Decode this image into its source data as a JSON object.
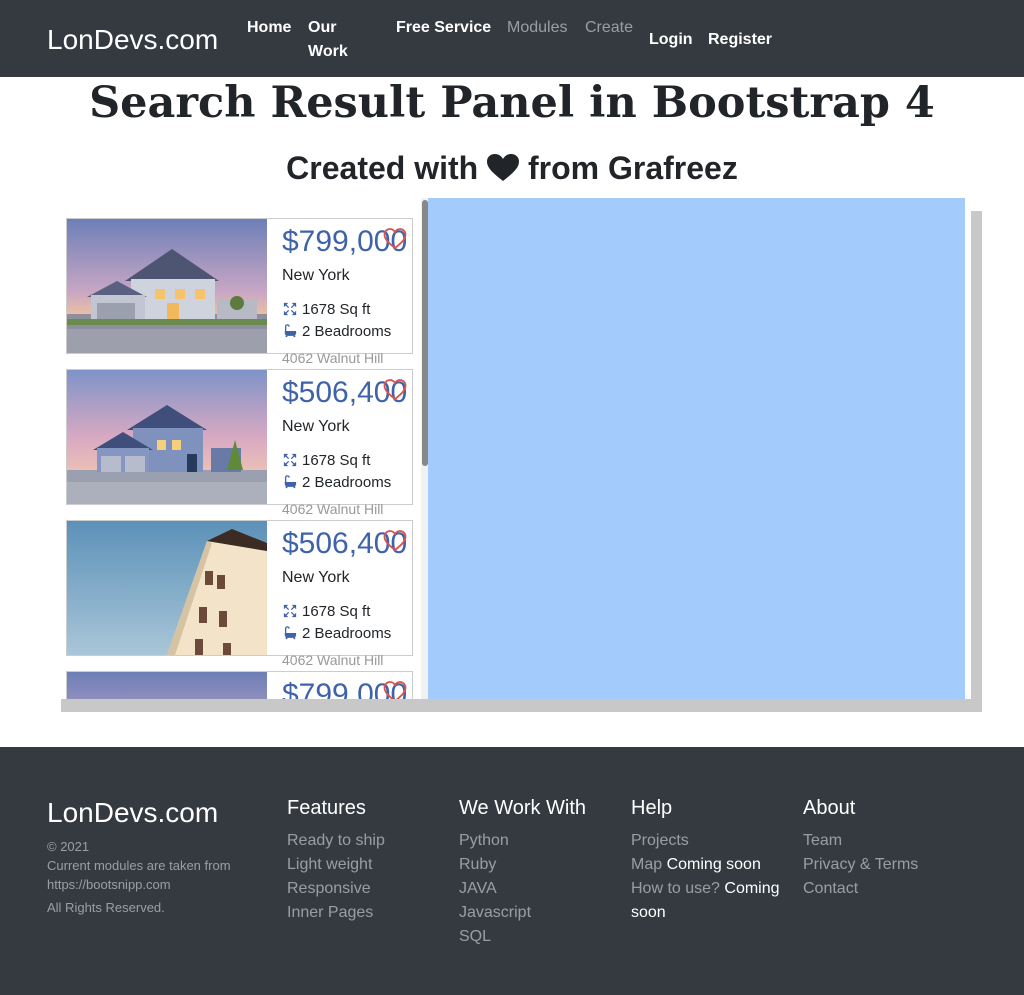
{
  "navbar": {
    "brand": "LonDevs.com",
    "items": [
      {
        "label": "Home",
        "active": true
      },
      {
        "label": "Our",
        "label2": "Work"
      },
      {
        "label": "Free Service"
      },
      {
        "label": "Modules",
        "muted": true
      },
      {
        "label": "Create",
        "muted": true
      },
      {
        "label": "Login"
      },
      {
        "label": "Register"
      }
    ]
  },
  "header": {
    "title": "Search Result Panel in Bootstrap 4",
    "subtitle_before": "Created with",
    "subtitle_after": "from Grafreez",
    "heart_icon": "heart-icon"
  },
  "listings": [
    {
      "price": "$799,000",
      "city": "New York",
      "area": "1678 Sq ft",
      "rooms": "2 Beadrooms",
      "address": "4062 Walnut Hill",
      "photo": "house-dusk"
    },
    {
      "price": "$506,400",
      "city": "New York",
      "area": "1678 Sq ft",
      "rooms": "2 Beadrooms",
      "address": "4062 Walnut Hill",
      "photo": "house-blue"
    },
    {
      "price": "$506,400",
      "city": "New York",
      "area": "1678 Sq ft",
      "rooms": "2 Beadrooms",
      "address": "4062 Walnut Hill",
      "photo": "house-cream"
    },
    {
      "price": "$799,000",
      "city": "",
      "area": "",
      "rooms": "",
      "address": "",
      "photo": "house-dusk"
    }
  ],
  "colors": {
    "navbar_bg": "#343a40",
    "price": "#3f63a9",
    "map_bg": "#a3cbfc",
    "fav_icon": "#d9534f"
  },
  "footer": {
    "brand": "LonDevs.com",
    "copyright": "© 2021",
    "note_line1": "Current modules are taken from",
    "note_line2": "https://bootsnipp.com",
    "rights": "All Rights Reserved.",
    "columns": [
      {
        "title": "Features",
        "links": [
          "Ready to ship",
          "Light weight",
          "Responsive",
          "Inner Pages"
        ]
      },
      {
        "title": "We Work With",
        "links": [
          "Python",
          "Ruby",
          "JAVA",
          "Javascript",
          "SQL"
        ]
      },
      {
        "title": "Help",
        "links": [
          "Projects",
          "Map",
          "How to use?"
        ],
        "soon": "Coming soon",
        "soon_line1": "Coming",
        "soon_line2": "soon"
      },
      {
        "title": "About",
        "links": [
          "Team",
          "Privacy & Terms",
          "Contact"
        ]
      }
    ]
  }
}
